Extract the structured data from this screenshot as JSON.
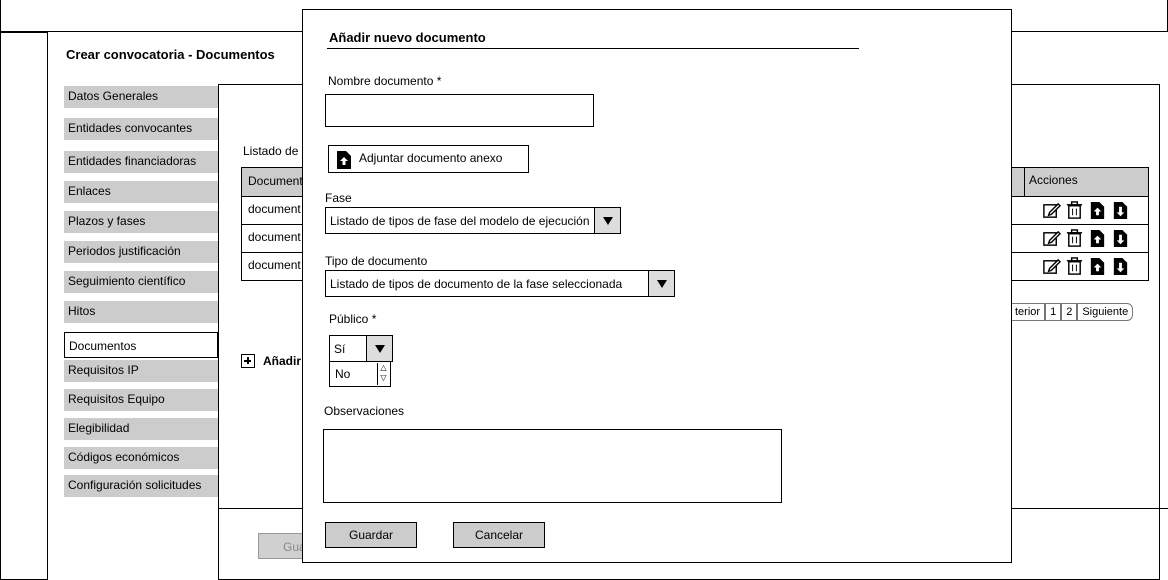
{
  "page": {
    "title": "Crear convocatoria - Documentos"
  },
  "sidebar": {
    "items": [
      {
        "label": "Datos Generales",
        "active": false
      },
      {
        "label": "Entidades convocantes",
        "active": false
      },
      {
        "label": "Entidades financiadoras",
        "active": false
      },
      {
        "label": "Enlaces",
        "active": false
      },
      {
        "label": "Plazos y fases",
        "active": false
      },
      {
        "label": "Periodos justificación",
        "active": false
      },
      {
        "label": "Seguimiento científico",
        "active": false
      },
      {
        "label": "Hitos",
        "active": false
      },
      {
        "label": "Documentos",
        "active": true
      },
      {
        "label": "Requisitos IP",
        "active": false
      },
      {
        "label": "Requisitos Equipo",
        "active": false
      },
      {
        "label": "Elegibilidad",
        "active": false
      },
      {
        "label": "Códigos económicos",
        "active": false
      },
      {
        "label": "Configuración solicitudes",
        "active": false
      }
    ]
  },
  "list": {
    "label": "Listado de d",
    "header_documents": "Document",
    "header_actions": "Acciones",
    "rows": [
      {
        "name": "document"
      },
      {
        "name": "document"
      },
      {
        "name": "document"
      }
    ],
    "row_action_icons": [
      "edit-icon",
      "trash-icon",
      "upload-icon",
      "download-icon"
    ]
  },
  "pagination": {
    "prev": "terior",
    "pages": [
      "1",
      "2"
    ],
    "next": "Siguiente"
  },
  "add_link": {
    "label": "Añadir"
  },
  "footer": {
    "save_label": "Gua"
  },
  "modal": {
    "title": "Añadir nuevo documento",
    "nombre_label": "Nombre documento",
    "required_mark": "*",
    "nombre_value": "",
    "attach_label": "Adjuntar documento anexo",
    "fase_label": "Fase",
    "fase_value": "Listado de tipos de fase del modelo de ejecución",
    "tipo_label": "Tipo de documento",
    "tipo_value": "Listado de tipos de documento de la fase seleccionada",
    "publico_label": "Público",
    "publico_value": "Sí",
    "publico_options": [
      "No"
    ],
    "observaciones_label": "Observaciones",
    "observaciones_value": "",
    "save_label": "Guardar",
    "cancel_label": "Cancelar"
  }
}
